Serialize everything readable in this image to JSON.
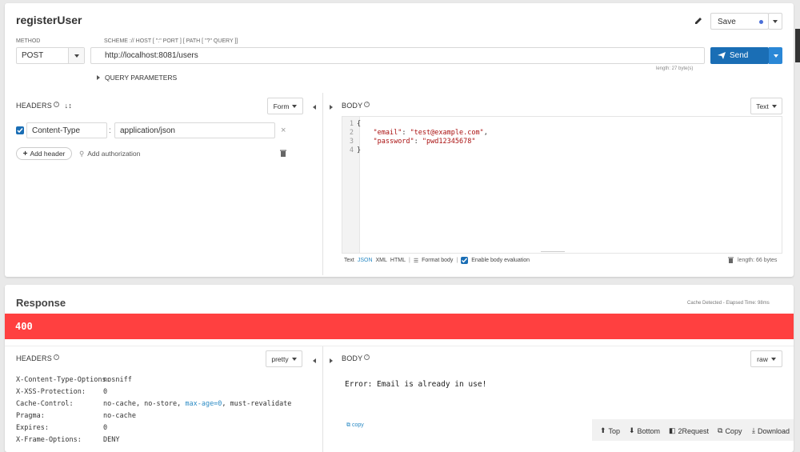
{
  "request": {
    "title": "registerUser",
    "save_label": "Save",
    "method_label": "METHOD",
    "url_label": "SCHEME :// HOST [ \":\" PORT ] [ PATH [ \"?\" QUERY ]]",
    "method_value": "POST",
    "url_value": "http://localhost:8081/users",
    "send_label": "Send",
    "url_length": "length: 27 byte(s)",
    "query_params_label": "QUERY PARAMETERS",
    "headers_label": "HEADERS",
    "headers_mode": "Form",
    "header_name": "Content-Type",
    "header_value": "application/json",
    "add_header_label": "Add header",
    "add_auth_label": "Add authorization",
    "body_label": "BODY",
    "body_mode": "Text",
    "body_lines": [
      "{",
      "    \"email\": \"test@example.com\",",
      "    \"password\": \"pwd12345678\"",
      "}"
    ],
    "body_line_numbers": [
      "1",
      "2",
      "3",
      "4"
    ],
    "body_email_key": "\"email\"",
    "body_email_value": "\"test@example.com\"",
    "body_password_key": "\"password\"",
    "body_password_value": "\"pwd12345678\"",
    "format_text": "Text",
    "format_json": "JSON",
    "format_xml": "XML",
    "format_html": "HTML",
    "format_body_label": "Format body",
    "enable_eval_label": "Enable body evaluation",
    "body_length": "length: 66 bytes"
  },
  "response": {
    "title": "Response",
    "cache_info": "Cache Detected - Elapsed Time: 98ms",
    "status_code": "400",
    "status_color": "#ff4040",
    "headers_label": "HEADERS",
    "headers_mode": "pretty",
    "body_label": "BODY",
    "body_mode": "raw",
    "headers": [
      {
        "name": "X-Content-Type-Options:",
        "value": "nosniff"
      },
      {
        "name": "X-XSS-Protection:",
        "value": "0"
      },
      {
        "name": "Cache-Control:",
        "value_parts": [
          "no-cache, no-store, ",
          "max-age=0",
          ", must-revalidate"
        ]
      },
      {
        "name": "Pragma:",
        "value": "no-cache"
      },
      {
        "name": "Expires:",
        "value": "0"
      },
      {
        "name": "X-Frame-Options:",
        "value": "DENY"
      }
    ],
    "body_text": "Error: Email is already in use!",
    "copy_label": "copy",
    "footer": {
      "top": "Top",
      "bottom": "Bottom",
      "to_request": "2Request",
      "copy": "Copy",
      "download": "Download"
    }
  },
  "colors": {
    "accent": "#1a6eb5",
    "send_bg": "#1a6eb5",
    "status_bg": "#ff4040",
    "json_active": "#2a8ac4"
  }
}
